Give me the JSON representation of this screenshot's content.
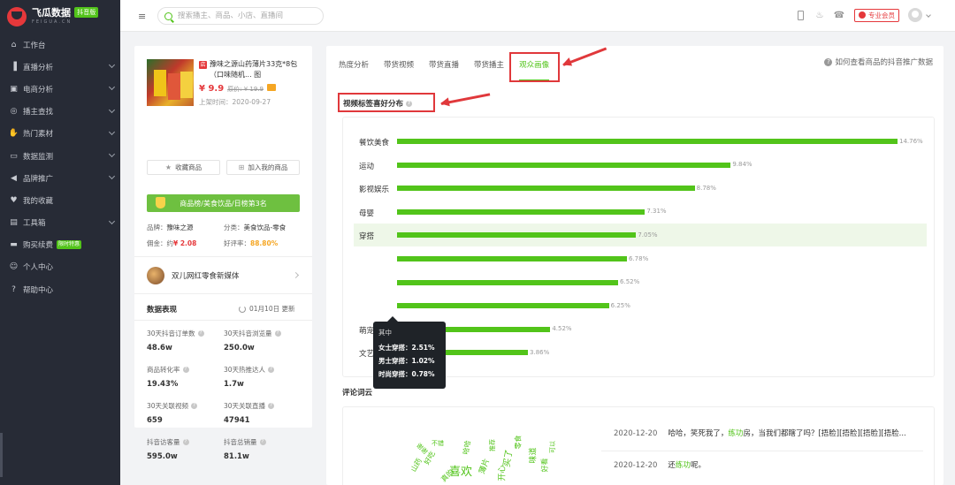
{
  "brand": {
    "name": "飞瓜数据",
    "sub": "FEIGUA.CN",
    "edition": "抖音版"
  },
  "sidebar": {
    "items": [
      {
        "label": "工作台",
        "icon": "home-icon",
        "chevron": false
      },
      {
        "label": "直播分析",
        "icon": "bar-chart-icon",
        "chevron": true
      },
      {
        "label": "电商分析",
        "icon": "bag-icon",
        "chevron": true
      },
      {
        "label": "播主查找",
        "icon": "search-icon",
        "chevron": true
      },
      {
        "label": "热门素材",
        "icon": "thumbs-up-icon",
        "chevron": true
      },
      {
        "label": "数据监测",
        "icon": "monitor-icon",
        "chevron": true
      },
      {
        "label": "品牌推广",
        "icon": "megaphone-icon",
        "chevron": true
      },
      {
        "label": "我的收藏",
        "icon": "heart-icon",
        "chevron": false
      },
      {
        "label": "工具箱",
        "icon": "toolbox-icon",
        "chevron": true
      },
      {
        "label": "购买续费",
        "icon": "card-icon",
        "chevron": false,
        "badge": "限时特惠"
      },
      {
        "label": "个人中心",
        "icon": "user-icon",
        "chevron": false
      },
      {
        "label": "帮助中心",
        "icon": "help-icon",
        "chevron": false
      }
    ]
  },
  "topbar": {
    "search_placeholder": "搜索播主、商品、小店、直播间",
    "pro_label": "专业会员"
  },
  "product": {
    "tag": "店",
    "title": "豫味之源山药薄片33克*8包（口味随机... 图",
    "price": "¥ 9.9",
    "old_price": "原价: ¥ 19.9",
    "list_time": "上架时间：2020-09-27",
    "fav_label": "收藏商品",
    "add_label": "加入我的商品",
    "rank_text": "商品榜/美食饮品/日榜第3名",
    "brand_label": "品牌：",
    "brand_value": "豫味之源",
    "category_label": "分类：",
    "category_value": "美食饮品-零食",
    "commission_label": "佣金：约",
    "commission_value": "¥ 2.08",
    "rating_label": "好评率：",
    "rating_value": "88.80%",
    "shop_name": "双儿网红零食新媒体"
  },
  "performance": {
    "title": "数据表现",
    "updated": "01月10日 更新",
    "stats": [
      {
        "label": "30天抖音订单数",
        "value": "48.6w"
      },
      {
        "label": "30天抖音浏览量",
        "value": "250.0w"
      },
      {
        "label": "商品转化率",
        "value": "19.43%"
      },
      {
        "label": "30天热推达人",
        "value": "1.7w"
      },
      {
        "label": "30天关联视频",
        "value": "659"
      },
      {
        "label": "30天关联直播",
        "value": "47941"
      },
      {
        "label": "抖音访客量",
        "value": "595.0w"
      },
      {
        "label": "抖音总销量",
        "value": "81.1w"
      }
    ]
  },
  "main": {
    "tabs": [
      "热度分析",
      "带货视频",
      "带货直播",
      "带货播主",
      "观众画像"
    ],
    "active_tab": 4,
    "help_text": "如何查看商品的抖音推广数据",
    "section_title": "视频标签喜好分布",
    "wordcloud_title": "评论词云"
  },
  "chart_data": {
    "type": "bar",
    "orientation": "horizontal",
    "title": "视频标签喜好分布",
    "categories": [
      "餐饮美食",
      "运动",
      "影视娱乐",
      "母婴",
      "穿搭",
      "",
      "",
      "",
      "萌宠",
      "文艺"
    ],
    "values": [
      14.76,
      9.84,
      8.78,
      7.31,
      7.05,
      6.78,
      6.52,
      6.25,
      4.52,
      3.86
    ],
    "value_labels": [
      "14.76%",
      "9.84%",
      "8.78%",
      "7.31%",
      "7.05%",
      "6.78%",
      "6.52%",
      "6.25%",
      "4.52%",
      "3.86%"
    ],
    "color": "#52c41a",
    "highlighted_index": 4,
    "tooltip": {
      "title": "其中",
      "rows": [
        "女士穿搭：2.51%",
        "男士穿搭：1.02%",
        "时尚穿搭：0.78%"
      ]
    }
  },
  "wordcloud": {
    "words": [
      "喜欢",
      "哈哈",
      "好吃",
      "推荐",
      "买了",
      "零食",
      "味道",
      "不错",
      "山药",
      "薄片",
      "好看",
      "真的",
      "开心",
      "可以",
      "谢谢"
    ]
  },
  "comments": [
    {
      "date": "2020-12-20",
      "pre": "哈哈，笑死我了，",
      "kw": "练功",
      "post": "房，当我们都瞎了吗？[捂脸][捂脸][捂脸][捂脸..."
    },
    {
      "date": "2020-12-20",
      "pre": "还",
      "kw": "练功",
      "post": "呢。"
    }
  ],
  "colors": {
    "accent": "#52c41a",
    "sidebar_bg": "#272b36",
    "annotation_red": "#e0383b",
    "price_red": "#e5383b"
  }
}
